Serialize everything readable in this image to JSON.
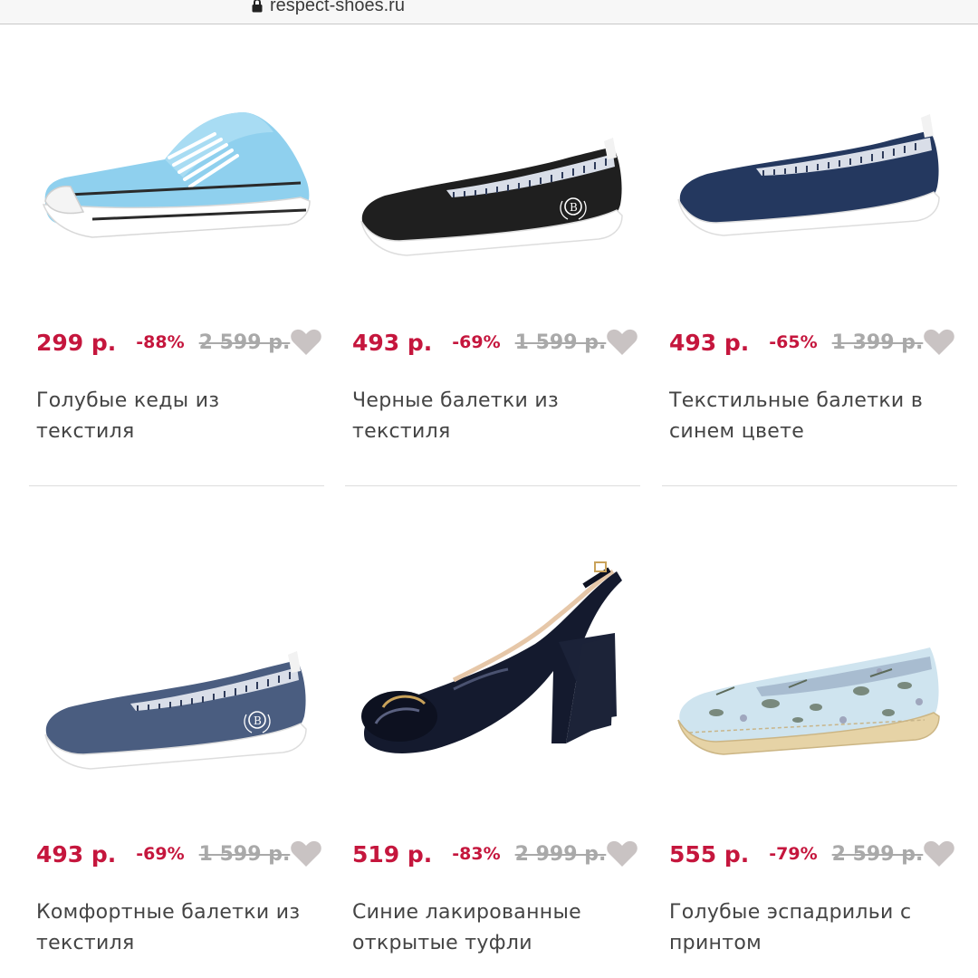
{
  "browser": {
    "url": "respect-shoes.ru",
    "icons": {
      "lock": "lock-icon"
    }
  },
  "colors": {
    "price": "#c5163d",
    "old_price": "#a9a9a9",
    "heart": "#c9c3c3",
    "text": "#444444"
  },
  "products": [
    {
      "price": "299 р.",
      "discount": "-88%",
      "old_price": "2 599 р.",
      "title": "Голубые кеды из текстиля",
      "image_icon": "blue-sneaker-image",
      "favorite_icon": "heart-icon"
    },
    {
      "price": "493 р.",
      "discount": "-69%",
      "old_price": "1 599 р.",
      "title": "Черные балетки из текстиля",
      "image_icon": "black-ballet-flat-image",
      "favorite_icon": "heart-icon"
    },
    {
      "price": "493 р.",
      "discount": "-65%",
      "old_price": "1 399 р.",
      "title": "Текстильные балетки в синем цвете",
      "image_icon": "navy-ballet-flat-image",
      "favorite_icon": "heart-icon"
    },
    {
      "price": "493 р.",
      "discount": "-69%",
      "old_price": "1 599 р.",
      "title": "Комфортные балетки из текстиля",
      "image_icon": "denim-ballet-flat-image",
      "favorite_icon": "heart-icon"
    },
    {
      "price": "519 р.",
      "discount": "-83%",
      "old_price": "2 999 р.",
      "title": "Синие лакированные открытые туфли",
      "image_icon": "patent-slingback-image",
      "favorite_icon": "heart-icon"
    },
    {
      "price": "555 р.",
      "discount": "-79%",
      "old_price": "2 599 р.",
      "title": "Голубые эспадрильи с принтом",
      "image_icon": "printed-espadrille-image",
      "favorite_icon": "heart-icon"
    }
  ]
}
